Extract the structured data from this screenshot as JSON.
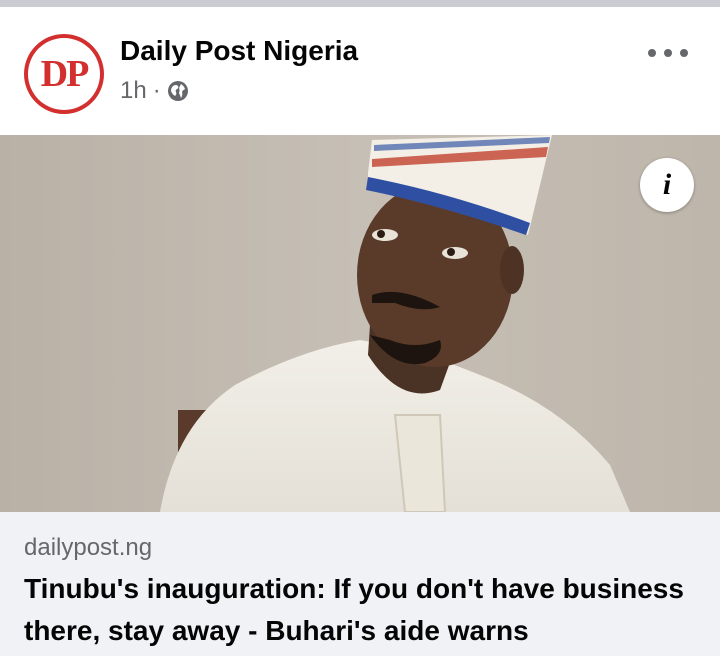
{
  "post": {
    "page_name": "Daily Post Nigeria",
    "avatar_text": "DP",
    "time": "1h",
    "separator": "·",
    "privacy_icon": "globe-icon",
    "more_icon": "more-options-icon"
  },
  "media": {
    "info_icon": "info-icon",
    "info_label": "i"
  },
  "link": {
    "domain": "dailypost.ng",
    "headline": "Tinubu's inauguration: If you don't have business there, stay away - Buhari's aide warns"
  },
  "colors": {
    "brand_red": "#d32f2f",
    "secondary_text": "#65676b",
    "preview_bg": "#f0f2f5"
  }
}
